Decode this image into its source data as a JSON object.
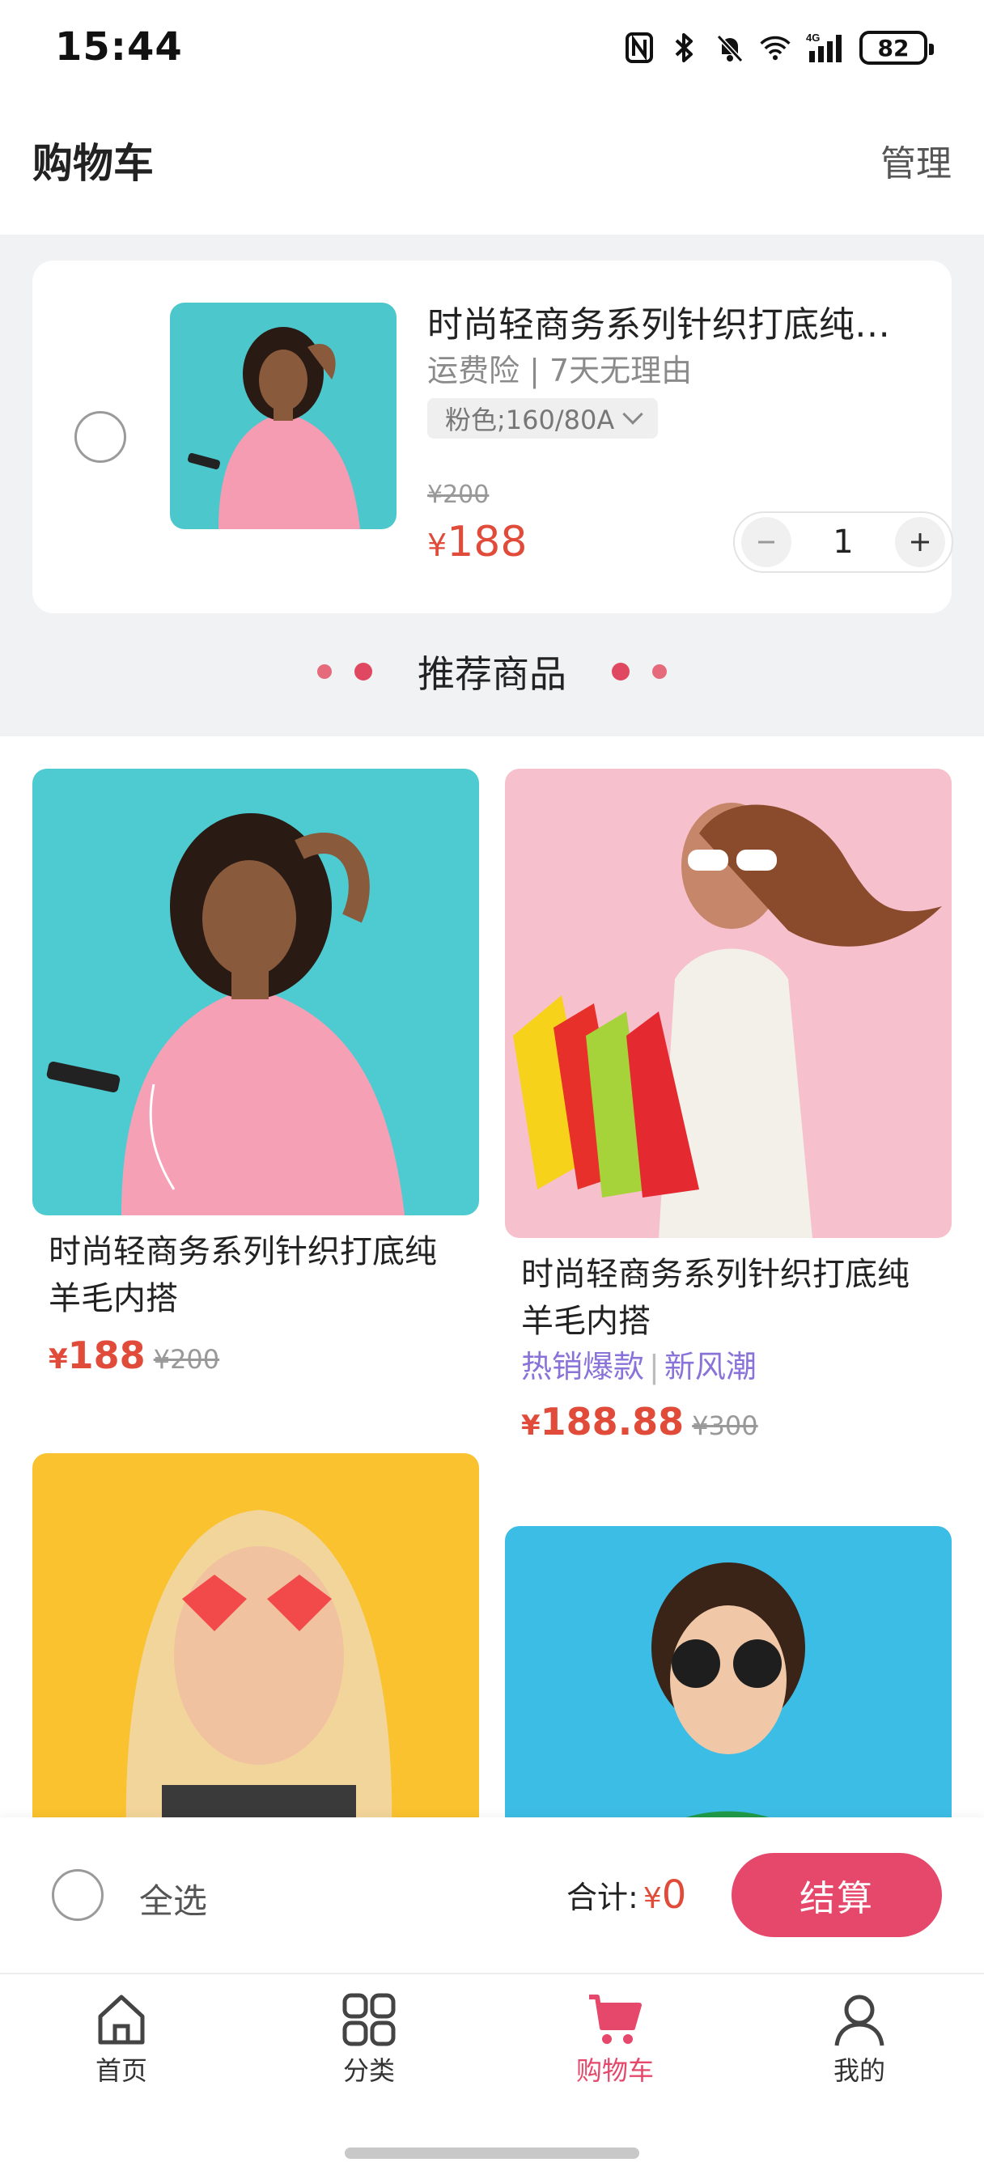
{
  "status": {
    "time": "15:44",
    "battery": "82"
  },
  "header": {
    "title": "购物车",
    "manage": "管理"
  },
  "cart_item": {
    "name": "时尚轻商务系列针织打底纯羊毛内搭",
    "tags": "运费险 | 7天无理由",
    "spec": "粉色;160/80A",
    "old_price": "¥200",
    "price_symbol": "¥",
    "price": "188",
    "quantity": "1",
    "selected": false
  },
  "recommend": {
    "title": "推荐商品"
  },
  "products": [
    {
      "name": "时尚轻商务系列针织打底纯羊毛内搭",
      "price_symbol": "¥",
      "price": "188",
      "old_price": "¥200"
    },
    {
      "name": "时尚轻商务系列针织打底纯羊毛内搭",
      "promo_a": "热销爆款",
      "promo_sep": "|",
      "promo_b": "新风潮",
      "price_symbol": "¥",
      "price": "188.88",
      "old_price": "¥300"
    }
  ],
  "checkout": {
    "select_all": "全选",
    "total_label": "合计:",
    "total_symbol": "¥",
    "total": "0",
    "pay": "结算"
  },
  "tabs": [
    {
      "label": "首页",
      "icon": "home-icon",
      "active": false
    },
    {
      "label": "分类",
      "icon": "category-grid-icon",
      "active": false
    },
    {
      "label": "购物车",
      "icon": "cart-icon",
      "active": true
    },
    {
      "label": "我的",
      "icon": "user-icon",
      "active": false
    }
  ],
  "colors": {
    "accent": "#e5486a",
    "price": "#e04b3a",
    "promo": "#8a73d8",
    "section_bg": "#f1f2f4"
  }
}
